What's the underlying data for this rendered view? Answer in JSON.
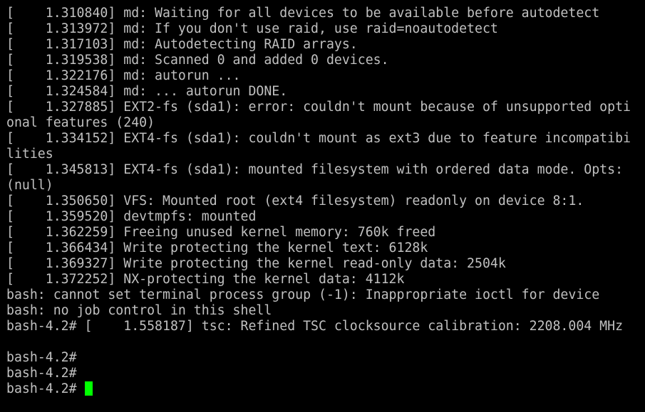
{
  "terminal": {
    "lines": [
      "[    1.310840] md: Waiting for all devices to be available before autodetect",
      "[    1.313972] md: If you don't use raid, use raid=noautodetect",
      "[    1.317103] md: Autodetecting RAID arrays.",
      "[    1.319538] md: Scanned 0 and added 0 devices.",
      "[    1.322176] md: autorun ...",
      "[    1.324584] md: ... autorun DONE.",
      "[    1.327885] EXT2-fs (sda1): error: couldn't mount because of unsupported opti",
      "onal features (240)",
      "[    1.334152] EXT4-fs (sda1): couldn't mount as ext3 due to feature incompatibi",
      "lities",
      "[    1.345813] EXT4-fs (sda1): mounted filesystem with ordered data mode. Opts:",
      "(null)",
      "[    1.350650] VFS: Mounted root (ext4 filesystem) readonly on device 8:1.",
      "[    1.359520] devtmpfs: mounted",
      "[    1.362259] Freeing unused kernel memory: 760k freed",
      "[    1.366434] Write protecting the kernel text: 6128k",
      "[    1.369327] Write protecting the kernel read-only data: 2504k",
      "[    1.372252] NX-protecting the kernel data: 4112k",
      "bash: cannot set terminal process group (-1): Inappropriate ioctl for device",
      "bash: no job control in this shell",
      "bash-4.2# [    1.558187] tsc: Refined TSC clocksource calibration: 2208.004 MHz",
      "",
      "bash-4.2#",
      "bash-4.2#",
      "bash-4.2# "
    ]
  },
  "colors": {
    "background": "#000000",
    "foreground": "#c0c0c0",
    "cursor": "#00ff00"
  }
}
